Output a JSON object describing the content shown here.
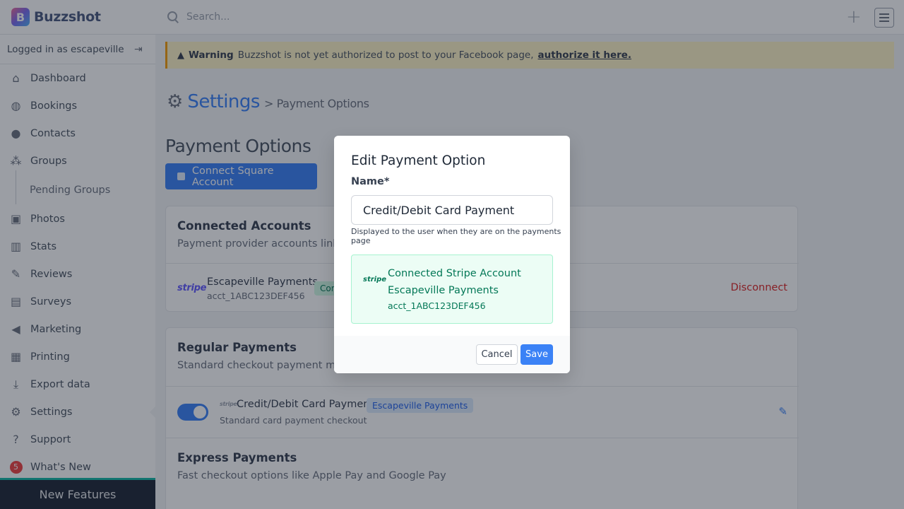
{
  "app": {
    "name": "Buzzshot",
    "logo_letter": "B"
  },
  "search": {
    "placeholder": "Search..."
  },
  "user": {
    "logged_in_text": "Logged in as escapeville"
  },
  "nav": [
    {
      "label": "Dashboard",
      "icon": "home-icon"
    },
    {
      "label": "Bookings",
      "icon": "globe-icon"
    },
    {
      "label": "Contacts",
      "icon": "user-icon"
    },
    {
      "label": "Groups",
      "icon": "users-icon"
    },
    {
      "label": "Pending Groups",
      "icon": ""
    },
    {
      "label": "Photos",
      "icon": "image-icon"
    },
    {
      "label": "Stats",
      "icon": "chart-icon"
    },
    {
      "label": "Reviews",
      "icon": "feather-icon"
    },
    {
      "label": "Surveys",
      "icon": "clipboard-icon"
    },
    {
      "label": "Marketing",
      "icon": "megaphone-icon"
    },
    {
      "label": "Printing",
      "icon": "printer-icon"
    },
    {
      "label": "Export data",
      "icon": "download-icon"
    },
    {
      "label": "Settings",
      "icon": "gear-icon"
    },
    {
      "label": "Support",
      "icon": "question-icon"
    },
    {
      "label": "What's New",
      "badge": "5"
    }
  ],
  "new_features": "New Features",
  "warning": {
    "label": "Warning",
    "text": "Buzzshot is not yet authorized to post to your Facebook page,",
    "link": "authorize it here."
  },
  "breadcrumb": {
    "section": "Settings",
    "page": "> Payment Options"
  },
  "page_heading": "Payment Options",
  "square_button": "Connect Square Account",
  "connected_accounts": {
    "title": "Connected Accounts",
    "desc": "Payment provider accounts linked",
    "account_name": "Escapeville Payments",
    "account_id": "acct_1ABC123DEF456",
    "provider": "stripe",
    "status": "Con",
    "disconnect": "Disconnect"
  },
  "regular_payments": {
    "title": "Regular Payments",
    "desc": "Standard checkout payment meth",
    "item_name": "Credit/Debit Card Payment",
    "item_account": "Escapeville Payments",
    "item_desc": "Standard card payment checkout",
    "provider": "stripe",
    "enabled": true
  },
  "express_payments": {
    "title": "Express Payments",
    "desc": "Fast checkout options like Apple Pay and Google Pay"
  },
  "modal": {
    "title": "Edit Payment Option",
    "name_label": "Name*",
    "name_value": "Credit/Debit Card Payment",
    "help": "Displayed to the user when they are on the payments page",
    "stripe_logo": "stripe",
    "stripe_heading": "Connected Stripe Account",
    "stripe_account": "Escapeville Payments",
    "stripe_id": "acct_1ABC123DEF456",
    "cancel": "Cancel",
    "save": "Save"
  }
}
